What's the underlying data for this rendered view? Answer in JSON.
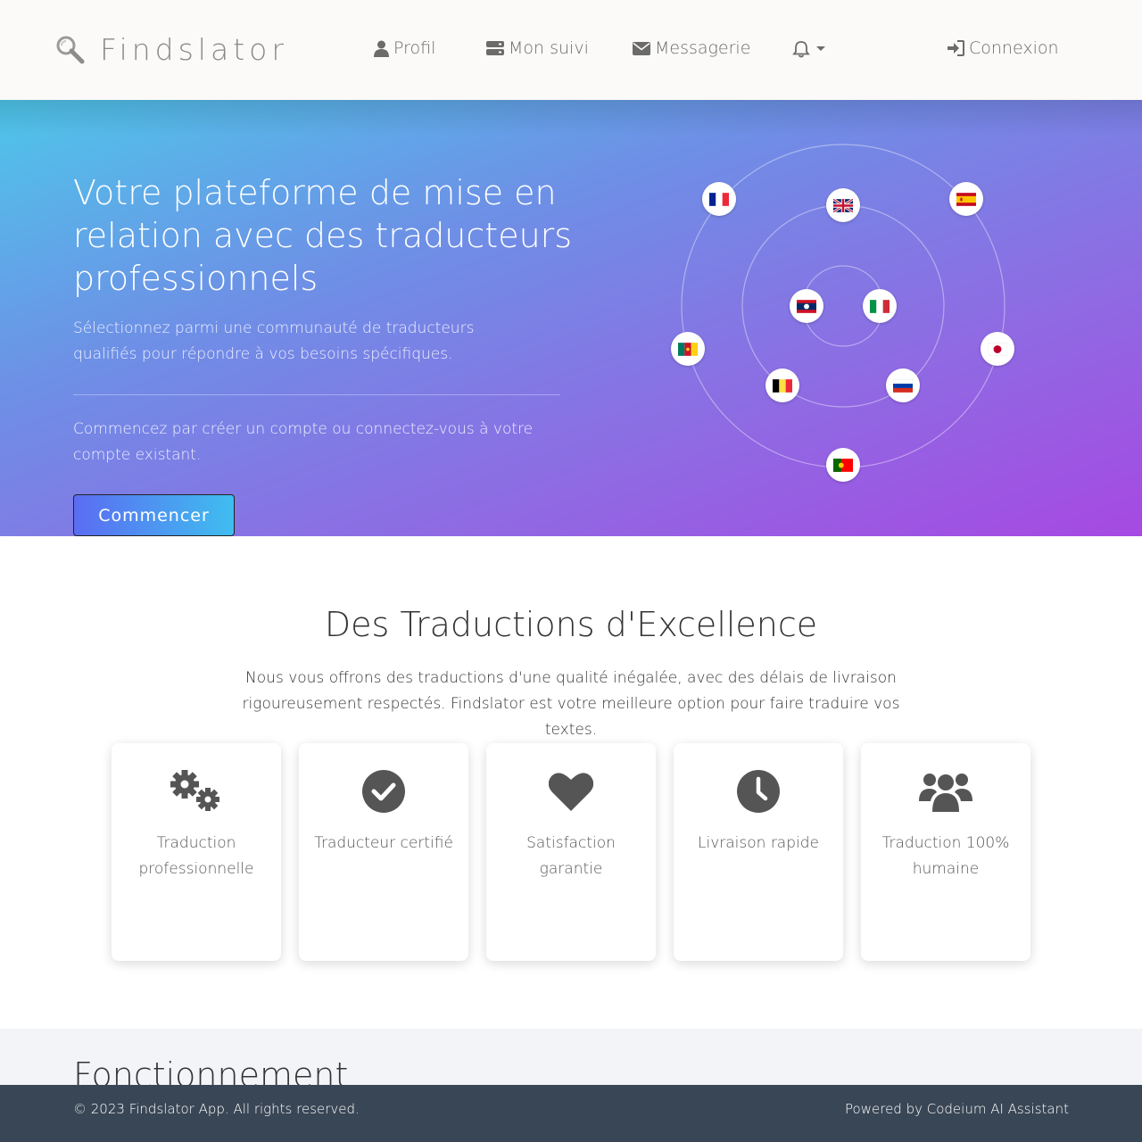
{
  "navbar": {
    "brand": "Findslator",
    "profil": "Profil",
    "suivi": "Mon suivi",
    "messagerie": "Messagerie",
    "connexion": "Connexion",
    "icons": [
      "search-icon",
      "user-icon",
      "tracking-icon",
      "envelope-icon",
      "bell-icon",
      "login-icon"
    ]
  },
  "hero": {
    "title": "Votre plateforme de mise en relation avec des traducteurs professionnels",
    "subtitle": "Sélectionnez parmi une communauté de traducteurs qualifiés pour répondre à vos besoins spécifiques.",
    "subtitle2": "Commencez par créer un compte ou connectez-vous à votre compte existant.",
    "cta": "Commencer",
    "flags": [
      "France",
      "United Kingdom",
      "Spain",
      "Laos",
      "Italy",
      "Cameroon",
      "Japan",
      "Belgium",
      "Russia",
      "Portugal"
    ],
    "colors": {
      "gradient_start": "#4ec6ea",
      "gradient_end": "#a649e2"
    }
  },
  "excellence": {
    "title": "Des Traductions d'Excellence",
    "subtitle": "Nous vous offrons des traductions d'une qualité inégalée, avec des délais de livraison rigoureusement respectés. Findslator est votre meilleure option pour faire traduire vos textes.",
    "cards": [
      {
        "label": "Traduction professionnelle",
        "icon": "gears-icon"
      },
      {
        "label": "Traducteur certifié",
        "icon": "check-circle-icon"
      },
      {
        "label": "Satisfaction garantie",
        "icon": "heart-icon"
      },
      {
        "label": "Livraison rapide",
        "icon": "clock-icon"
      },
      {
        "label": "Traduction 100% humaine",
        "icon": "users-icon"
      }
    ]
  },
  "fonctionnement": {
    "title": "Fonctionnement"
  },
  "footer": {
    "copyright": "© 2023 Findslator App. All rights reserved.",
    "powered": "Powered by Codeium AI Assistant"
  }
}
